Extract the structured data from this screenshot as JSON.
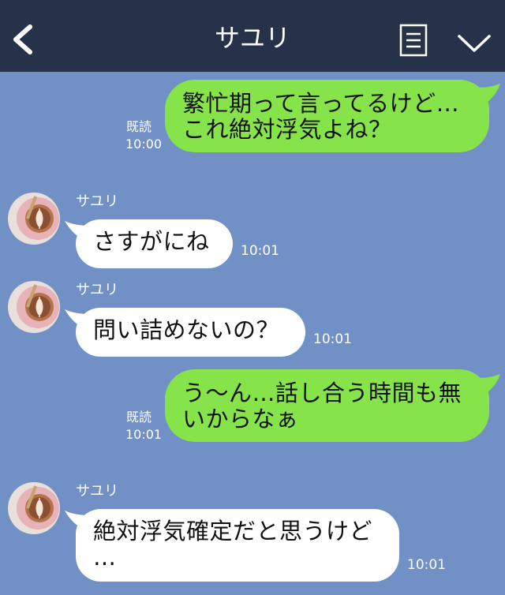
{
  "header": {
    "title": "サユリ",
    "back_icon": "chevron-left-icon",
    "menu_icon": "menu-list-icon",
    "collapse_icon": "chevron-down-icon",
    "background": "#263249"
  },
  "chat": {
    "background": "#7191c6",
    "outgoing_color": "#86e34a",
    "incoming_color": "#ffffff",
    "messages": [
      {
        "direction": "out",
        "text": "繁忙期って言ってるけど…\nこれ絶対浮気よね？",
        "read": "既読",
        "time": "10:00"
      },
      {
        "direction": "in",
        "sender": "サユリ",
        "text": "さすがにね",
        "time": "10:01"
      },
      {
        "direction": "in",
        "sender": "サユリ",
        "text": "問い詰めないの？",
        "time": "10:01"
      },
      {
        "direction": "out",
        "text": "う〜ん…話し合う時間も無\nいからなぁ",
        "read": "既読",
        "time": "10:01"
      },
      {
        "direction": "in",
        "sender": "サユリ",
        "text": "絶対浮気確定だと思うけど\n…",
        "time": "10:01"
      }
    ]
  }
}
